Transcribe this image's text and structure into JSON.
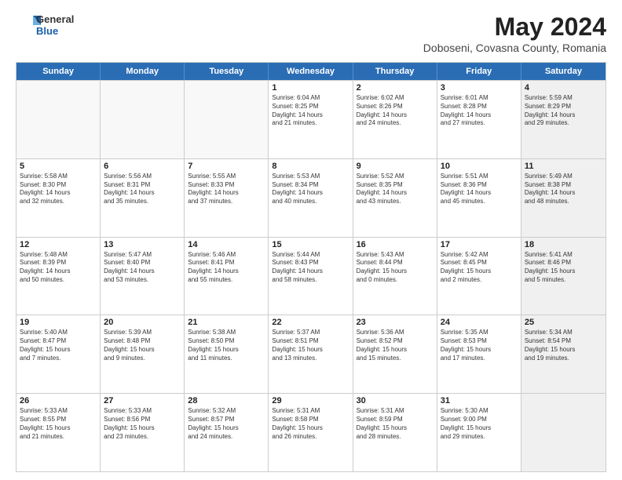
{
  "header": {
    "logo_general": "General",
    "logo_blue": "Blue",
    "month_year": "May 2024",
    "location": "Doboseni, Covasna County, Romania"
  },
  "days_of_week": [
    "Sunday",
    "Monday",
    "Tuesday",
    "Wednesday",
    "Thursday",
    "Friday",
    "Saturday"
  ],
  "rows": [
    [
      {
        "day": "",
        "text": "",
        "empty": true
      },
      {
        "day": "",
        "text": "",
        "empty": true
      },
      {
        "day": "",
        "text": "",
        "empty": true
      },
      {
        "day": "1",
        "text": "Sunrise: 6:04 AM\nSunset: 8:25 PM\nDaylight: 14 hours\nand 21 minutes.",
        "empty": false
      },
      {
        "day": "2",
        "text": "Sunrise: 6:02 AM\nSunset: 8:26 PM\nDaylight: 14 hours\nand 24 minutes.",
        "empty": false
      },
      {
        "day": "3",
        "text": "Sunrise: 6:01 AM\nSunset: 8:28 PM\nDaylight: 14 hours\nand 27 minutes.",
        "empty": false
      },
      {
        "day": "4",
        "text": "Sunrise: 5:59 AM\nSunset: 8:29 PM\nDaylight: 14 hours\nand 29 minutes.",
        "empty": false,
        "shaded": true
      }
    ],
    [
      {
        "day": "5",
        "text": "Sunrise: 5:58 AM\nSunset: 8:30 PM\nDaylight: 14 hours\nand 32 minutes.",
        "empty": false
      },
      {
        "day": "6",
        "text": "Sunrise: 5:56 AM\nSunset: 8:31 PM\nDaylight: 14 hours\nand 35 minutes.",
        "empty": false
      },
      {
        "day": "7",
        "text": "Sunrise: 5:55 AM\nSunset: 8:33 PM\nDaylight: 14 hours\nand 37 minutes.",
        "empty": false
      },
      {
        "day": "8",
        "text": "Sunrise: 5:53 AM\nSunset: 8:34 PM\nDaylight: 14 hours\nand 40 minutes.",
        "empty": false
      },
      {
        "day": "9",
        "text": "Sunrise: 5:52 AM\nSunset: 8:35 PM\nDaylight: 14 hours\nand 43 minutes.",
        "empty": false
      },
      {
        "day": "10",
        "text": "Sunrise: 5:51 AM\nSunset: 8:36 PM\nDaylight: 14 hours\nand 45 minutes.",
        "empty": false
      },
      {
        "day": "11",
        "text": "Sunrise: 5:49 AM\nSunset: 8:38 PM\nDaylight: 14 hours\nand 48 minutes.",
        "empty": false,
        "shaded": true
      }
    ],
    [
      {
        "day": "12",
        "text": "Sunrise: 5:48 AM\nSunset: 8:39 PM\nDaylight: 14 hours\nand 50 minutes.",
        "empty": false
      },
      {
        "day": "13",
        "text": "Sunrise: 5:47 AM\nSunset: 8:40 PM\nDaylight: 14 hours\nand 53 minutes.",
        "empty": false
      },
      {
        "day": "14",
        "text": "Sunrise: 5:46 AM\nSunset: 8:41 PM\nDaylight: 14 hours\nand 55 minutes.",
        "empty": false
      },
      {
        "day": "15",
        "text": "Sunrise: 5:44 AM\nSunset: 8:43 PM\nDaylight: 14 hours\nand 58 minutes.",
        "empty": false
      },
      {
        "day": "16",
        "text": "Sunrise: 5:43 AM\nSunset: 8:44 PM\nDaylight: 15 hours\nand 0 minutes.",
        "empty": false
      },
      {
        "day": "17",
        "text": "Sunrise: 5:42 AM\nSunset: 8:45 PM\nDaylight: 15 hours\nand 2 minutes.",
        "empty": false
      },
      {
        "day": "18",
        "text": "Sunrise: 5:41 AM\nSunset: 8:46 PM\nDaylight: 15 hours\nand 5 minutes.",
        "empty": false,
        "shaded": true
      }
    ],
    [
      {
        "day": "19",
        "text": "Sunrise: 5:40 AM\nSunset: 8:47 PM\nDaylight: 15 hours\nand 7 minutes.",
        "empty": false
      },
      {
        "day": "20",
        "text": "Sunrise: 5:39 AM\nSunset: 8:48 PM\nDaylight: 15 hours\nand 9 minutes.",
        "empty": false
      },
      {
        "day": "21",
        "text": "Sunrise: 5:38 AM\nSunset: 8:50 PM\nDaylight: 15 hours\nand 11 minutes.",
        "empty": false
      },
      {
        "day": "22",
        "text": "Sunrise: 5:37 AM\nSunset: 8:51 PM\nDaylight: 15 hours\nand 13 minutes.",
        "empty": false
      },
      {
        "day": "23",
        "text": "Sunrise: 5:36 AM\nSunset: 8:52 PM\nDaylight: 15 hours\nand 15 minutes.",
        "empty": false
      },
      {
        "day": "24",
        "text": "Sunrise: 5:35 AM\nSunset: 8:53 PM\nDaylight: 15 hours\nand 17 minutes.",
        "empty": false
      },
      {
        "day": "25",
        "text": "Sunrise: 5:34 AM\nSunset: 8:54 PM\nDaylight: 15 hours\nand 19 minutes.",
        "empty": false,
        "shaded": true
      }
    ],
    [
      {
        "day": "26",
        "text": "Sunrise: 5:33 AM\nSunset: 8:55 PM\nDaylight: 15 hours\nand 21 minutes.",
        "empty": false
      },
      {
        "day": "27",
        "text": "Sunrise: 5:33 AM\nSunset: 8:56 PM\nDaylight: 15 hours\nand 23 minutes.",
        "empty": false
      },
      {
        "day": "28",
        "text": "Sunrise: 5:32 AM\nSunset: 8:57 PM\nDaylight: 15 hours\nand 24 minutes.",
        "empty": false
      },
      {
        "day": "29",
        "text": "Sunrise: 5:31 AM\nSunset: 8:58 PM\nDaylight: 15 hours\nand 26 minutes.",
        "empty": false
      },
      {
        "day": "30",
        "text": "Sunrise: 5:31 AM\nSunset: 8:59 PM\nDaylight: 15 hours\nand 28 minutes.",
        "empty": false
      },
      {
        "day": "31",
        "text": "Sunrise: 5:30 AM\nSunset: 9:00 PM\nDaylight: 15 hours\nand 29 minutes.",
        "empty": false
      },
      {
        "day": "",
        "text": "",
        "empty": true,
        "shaded": true
      }
    ]
  ]
}
